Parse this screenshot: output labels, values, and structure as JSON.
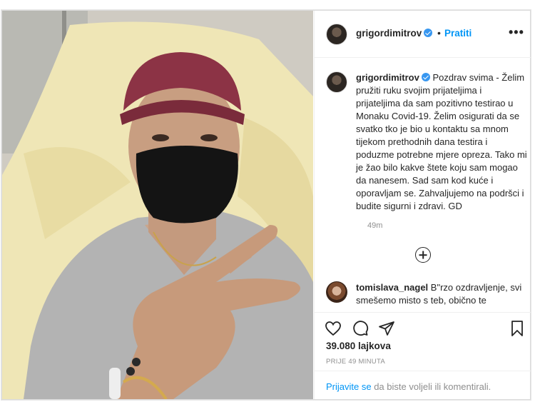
{
  "post": {
    "username": "grigordimitrov",
    "follow_label": "Pratiti",
    "dot": "•",
    "more_label": "•••",
    "caption": "Pozdrav svima - Želim pružiti ruku svojim prijateljima i prijateljima da sam pozitivno testirao u Monaku Covid-19. Želim osigurati da se svatko tko je bio u kontaktu sa mnom tijekom prethodnih dana testira i poduzme potrebne mjere opreza. Tako mi je žao bilo kakve štete koju sam mogao da nanesem. Sad sam kod kuće i oporavljam se. Zahvaljujemo na podršci i budite sigurni i zdravi. GD",
    "time_ago": "49m",
    "likes": "39.080 lajkova",
    "posted": "PRIJE 49 MINUTA"
  },
  "comment": {
    "username": "tomislava_nagel",
    "text": "B\"rzo ozdravljenje, svi smešemo misto s teb, obično te"
  },
  "footer": {
    "link": "Prijavite se",
    "rest": " da biste voljeli ili komentirali."
  },
  "icons": {
    "like": "heart-icon",
    "comment": "comment-icon",
    "share": "share-icon",
    "save": "bookmark-icon",
    "load_more": "plus-circle-icon"
  },
  "colors": {
    "accent": "#0095f6",
    "verified": "#3897f0",
    "muted": "#8e8e8e",
    "text": "#262626"
  }
}
